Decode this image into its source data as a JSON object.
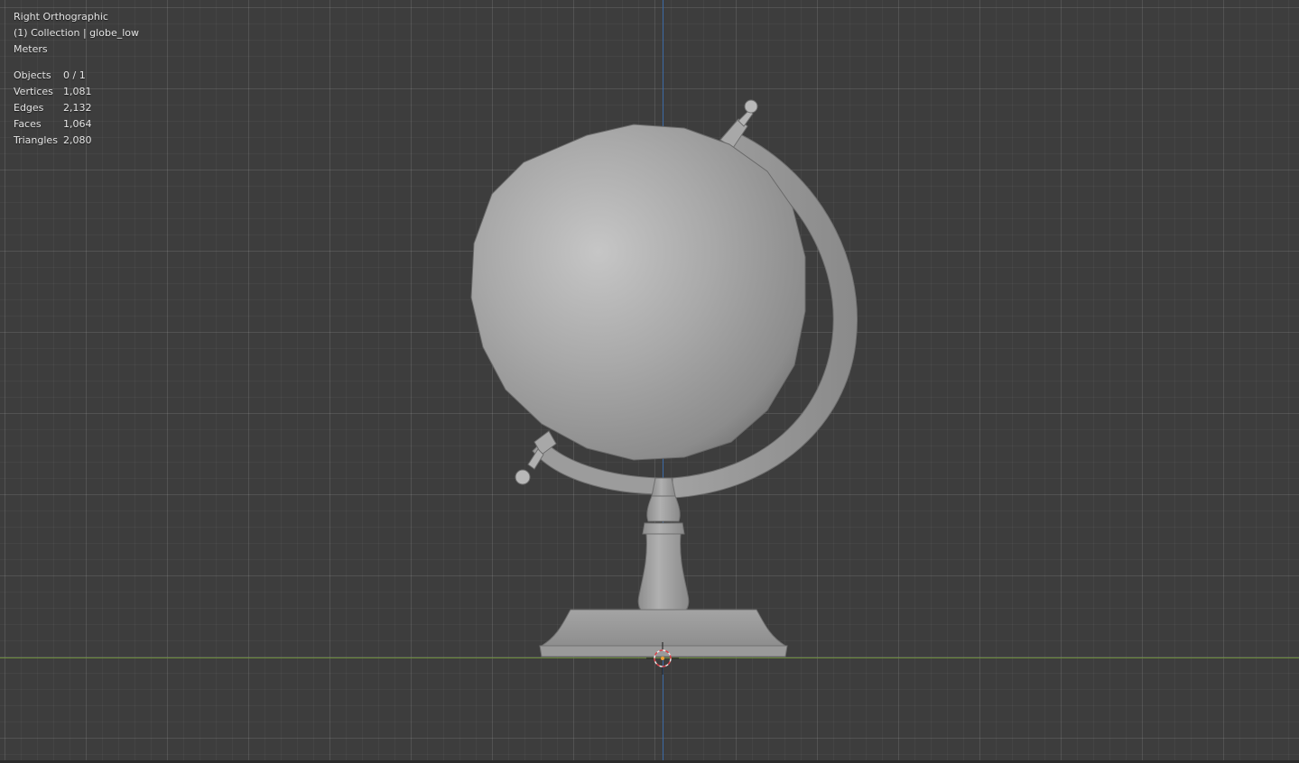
{
  "viewport": {
    "view_name": "Right Orthographic",
    "collection_label": "(1) Collection | globe_low",
    "units": "Meters",
    "stats": [
      {
        "label": "Objects",
        "value": "0 / 1"
      },
      {
        "label": "Vertices",
        "value": "1,081"
      },
      {
        "label": "Edges",
        "value": "2,132"
      },
      {
        "label": "Faces",
        "value": "1,064"
      },
      {
        "label": "Triangles",
        "value": "2,080"
      }
    ],
    "colors": {
      "background": "#3d3d3d",
      "x_axis": "#6a8a3a",
      "z_axis": "#3c6aa6",
      "mesh": "#9a9a9a"
    }
  }
}
